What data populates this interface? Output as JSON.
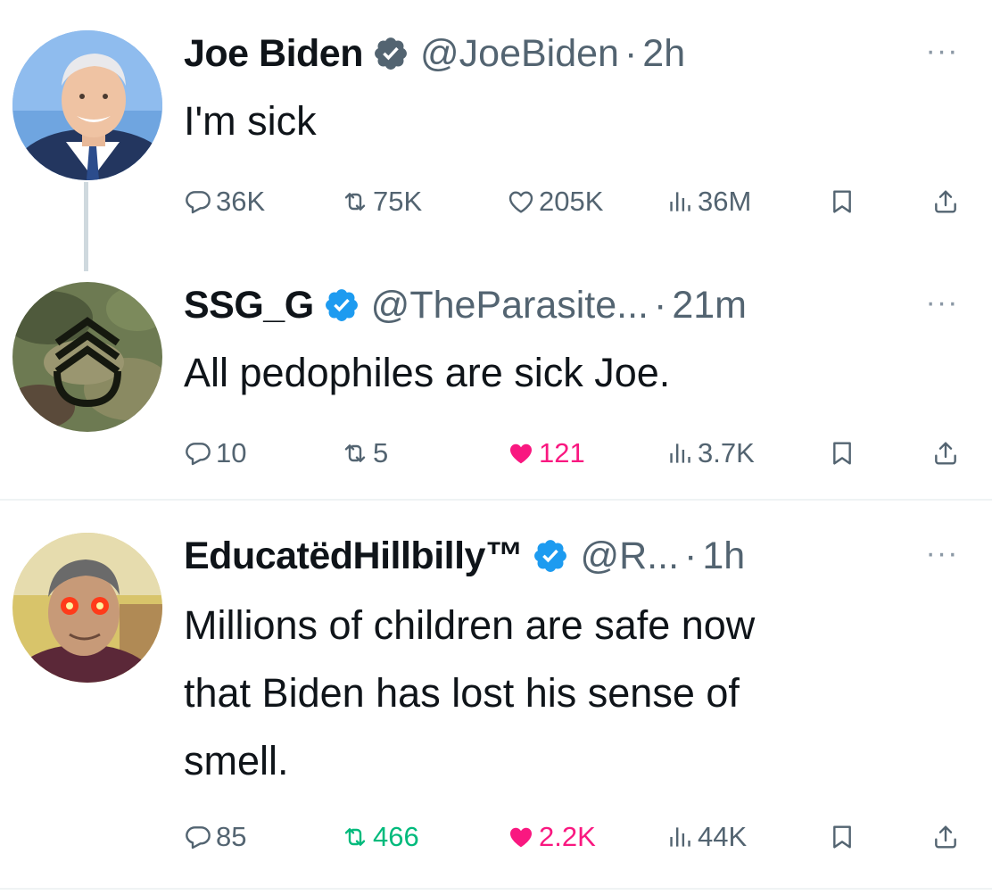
{
  "tweets": [
    {
      "name": "Joe Biden",
      "handle": "@JoeBiden",
      "dot": "·",
      "time": "2h",
      "text": "I'm sick",
      "more": "···",
      "replies": "36K",
      "retweets": "75K",
      "likes": "205K",
      "views": "36M",
      "liked": false,
      "retweeted": false
    },
    {
      "name": "SSG_G",
      "handle": "@TheParasite...",
      "dot": "·",
      "time": "21m",
      "text": "All pedophiles are sick Joe.",
      "more": "···",
      "replies": "10",
      "retweets": "5",
      "likes": "121",
      "views": "3.7K",
      "liked": true,
      "retweeted": false
    },
    {
      "name": "EducatëdHillbilly™",
      "handle": "@R...",
      "dot": "·",
      "time": "1h",
      "text_lines": [
        "Millions of children are safe now",
        "that Biden has lost his sense of",
        "smell."
      ],
      "more": "···",
      "replies": "85",
      "retweets": "466",
      "likes": "2.2K",
      "views": "44K",
      "liked": true,
      "retweeted": true
    }
  ],
  "colors": {
    "verified": "#1d9bf0",
    "like_active": "#f91880",
    "retweet_active": "#00ba7c",
    "muted": "#536471"
  },
  "icons": [
    "verified-badge-icon",
    "reply-icon",
    "retweet-icon",
    "like-icon",
    "views-icon",
    "bookmark-icon",
    "share-icon",
    "more-icon"
  ]
}
